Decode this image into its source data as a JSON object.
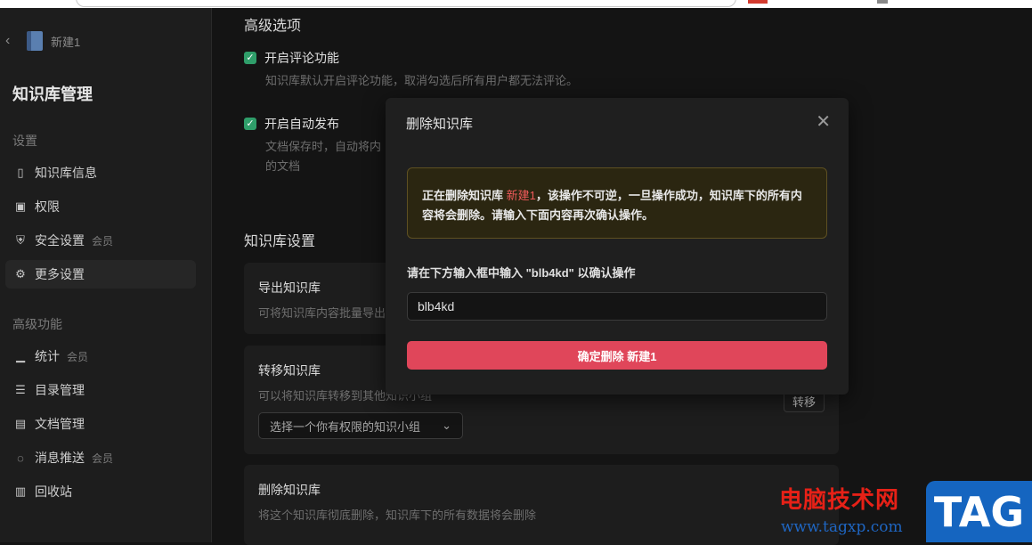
{
  "sidebar": {
    "kb_name": "新建1",
    "title": "知识库管理",
    "section_settings": "设置",
    "section_advanced": "高级功能",
    "items": [
      {
        "label": "知识库信息",
        "badge": ""
      },
      {
        "label": "权限",
        "badge": ""
      },
      {
        "label": "安全设置",
        "badge": "会员"
      },
      {
        "label": "更多设置",
        "badge": ""
      },
      {
        "label": "统计",
        "badge": "会员"
      },
      {
        "label": "目录管理",
        "badge": ""
      },
      {
        "label": "文档管理",
        "badge": ""
      },
      {
        "label": "消息推送",
        "badge": "会员"
      },
      {
        "label": "回收站",
        "badge": ""
      }
    ]
  },
  "main": {
    "advanced_title": "高级选项",
    "comments_label": "开启评论功能",
    "comments_desc": "知识库默认开启评论功能，取消勾选后所有用户都无法评论。",
    "autopublish_label": "开启自动发布",
    "autopublish_desc_1": "文档保存时，自动将内",
    "autopublish_desc_2": "的文档",
    "kb_settings_title": "知识库设置",
    "export": {
      "title": "导出知识库",
      "desc": "可将知识库内容批量导出"
    },
    "transfer": {
      "title": "转移知识库",
      "desc": "可以将知识库转移到其他知识小组",
      "select_value": "选择一个你有权限的知识小组",
      "button": "转移"
    },
    "delete": {
      "title": "删除知识库",
      "desc": "将这个知识库彻底删除，知识库下的所有数据将会删除"
    }
  },
  "modal": {
    "title": "删除知识库",
    "warn_prefix": "正在删除知识库 ",
    "warn_kb": "新建1",
    "warn_suffix": "，该操作不可逆，一旦操作成功，知识库下的所有内容将会删除。请输入下面内容再次确认操作。",
    "confirm_label": "请在下方输入框中输入 \"blb4kd\" 以确认操作",
    "input_value": "blb4kd",
    "delete_button": "确定删除 新建1"
  },
  "watermark": {
    "text": "电脑技术网",
    "url": "www.tagxp.com",
    "tag": "TAG"
  },
  "colors": {
    "checkbox": "#2f9e6a",
    "danger": "#e0465a",
    "warn_bg": "#2b2611",
    "kb_highlight": "#f05a5a"
  }
}
